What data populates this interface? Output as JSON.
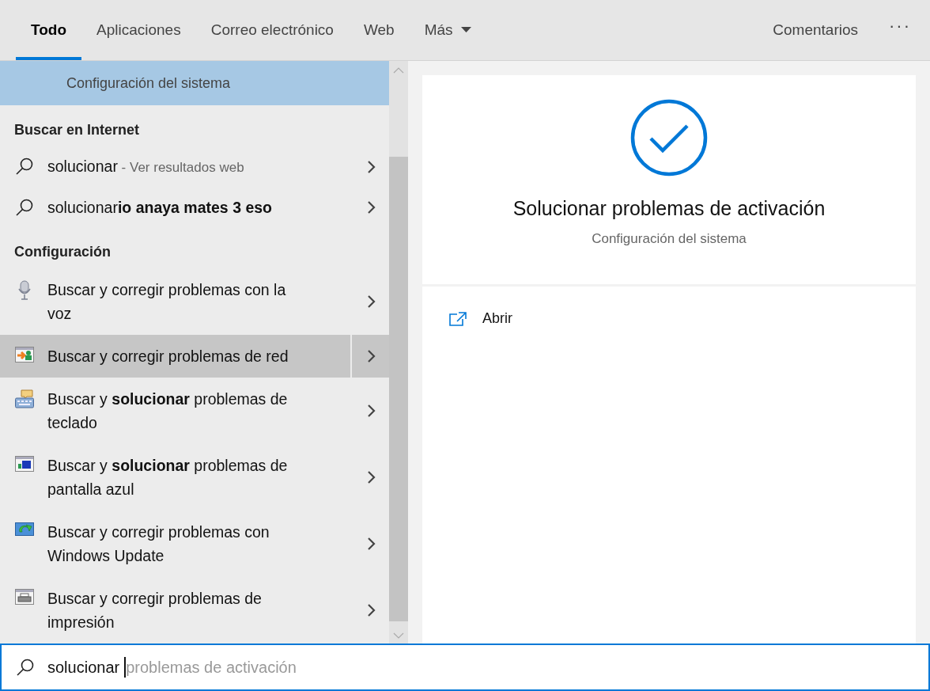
{
  "tabs": [
    {
      "label": "Todo",
      "selected": true,
      "dropdown": false
    },
    {
      "label": "Aplicaciones",
      "selected": false,
      "dropdown": false
    },
    {
      "label": "Correo electrónico",
      "selected": false,
      "dropdown": false
    },
    {
      "label": "Web",
      "selected": false,
      "dropdown": false
    },
    {
      "label": "Más",
      "selected": false,
      "dropdown": true
    }
  ],
  "feedback_link": "Comentarios",
  "more_button": "···",
  "results": {
    "top_item": {
      "text": "Configuración del sistema",
      "selected": true
    },
    "sections": [
      {
        "header": "Buscar en Internet",
        "items": [
          {
            "kind": "web",
            "text": "solucionar",
            "hint": "- Ver resultados web",
            "highlighted": false
          },
          {
            "kind": "web",
            "text": "solucionar**io anaya mates 3 eso**",
            "highlighted": false
          }
        ]
      },
      {
        "header": "Configuración",
        "items": [
          {
            "kind": "setting",
            "text": "Buscar y corregir problemas con la voz",
            "highlighted": false
          },
          {
            "kind": "setting",
            "text": "Buscar y corregir problemas de red",
            "highlighted": true
          },
          {
            "kind": "setting",
            "text": "Buscar y **solucionar** problemas de teclado",
            "highlighted": false
          },
          {
            "kind": "setting",
            "text": "Buscar y **solucionar** problemas de pantalla azul",
            "highlighted": false
          },
          {
            "kind": "setting",
            "text": "Buscar y corregir problemas con Windows Update",
            "highlighted": false
          },
          {
            "kind": "setting",
            "text": "Buscar y corregir problemas de impresión",
            "highlighted": false
          }
        ]
      }
    ]
  },
  "preview": {
    "title": "Solucionar problemas de activación",
    "subtitle": "Configuración del sistema",
    "actions": [
      {
        "label": "Abrir"
      }
    ]
  },
  "search": {
    "value": "solucionar",
    "suggestion": "problemas de activación"
  }
}
